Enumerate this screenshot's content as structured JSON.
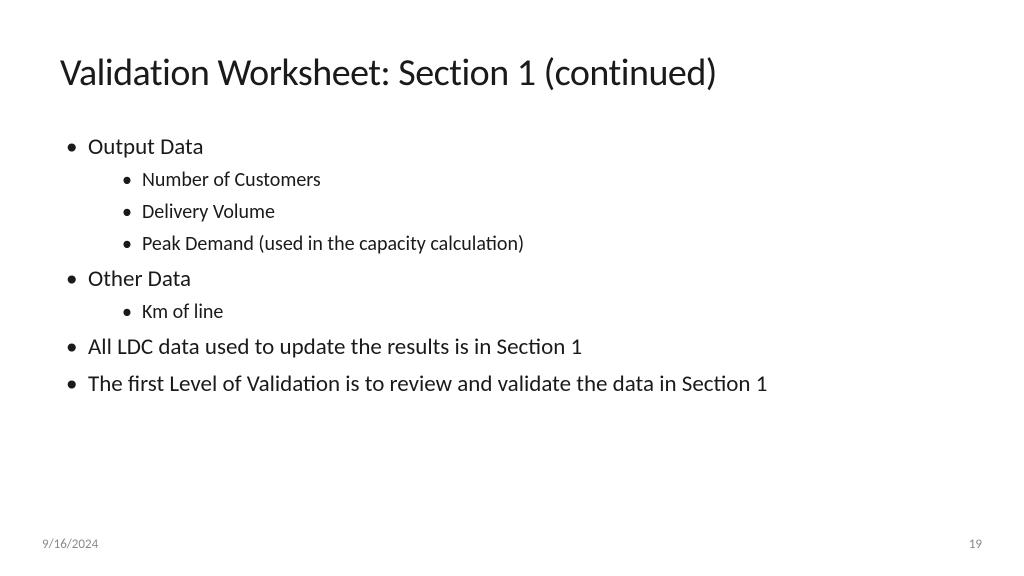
{
  "slide": {
    "title": "Validation Worksheet: Section 1 (continued)",
    "bullets": [
      {
        "text": "Output Data",
        "sub": [
          "Number of Customers",
          "Delivery Volume",
          "Peak Demand (used in the capacity calculation)"
        ]
      },
      {
        "text": "Other Data",
        "sub": [
          "Km of line"
        ]
      },
      {
        "text": "All LDC data used to update the results is in Section 1",
        "sub": []
      },
      {
        "text": "The first Level of Validation is to review and validate the data in Section 1",
        "sub": []
      }
    ]
  },
  "footer": {
    "date": "9/16/2024",
    "page": "19"
  }
}
